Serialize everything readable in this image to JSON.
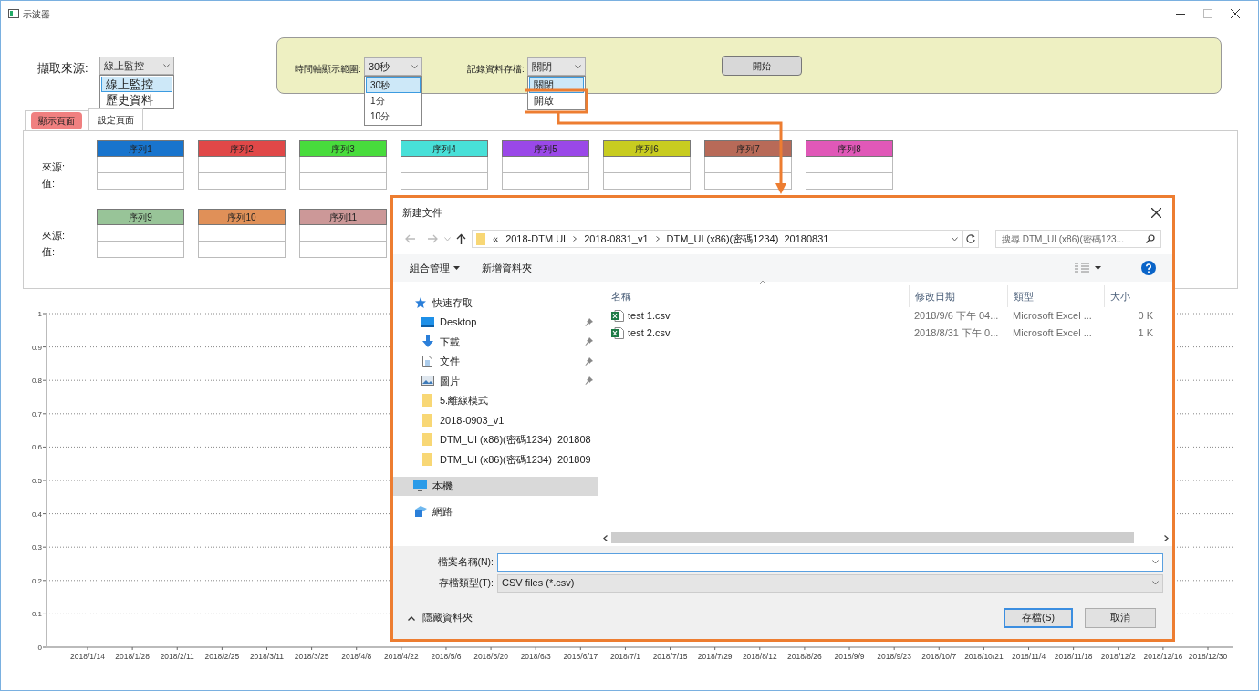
{
  "window": {
    "title": "示波器"
  },
  "source": {
    "label": "擷取來源:",
    "value": "線上監控",
    "options": [
      {
        "label": "線上監控",
        "selected": true
      },
      {
        "label": "歷史資料",
        "selected": false
      }
    ]
  },
  "settings_panel": {
    "time_range": {
      "label": "時間軸顯示範圍:",
      "value": "30秒",
      "options": [
        {
          "label": "30秒",
          "selected": true
        },
        {
          "label": "1分",
          "selected": false
        },
        {
          "label": "10分",
          "selected": false
        }
      ]
    },
    "record": {
      "label": "記錄資料存檔:",
      "value": "關閉",
      "options": [
        {
          "label": "關閉",
          "selected": true
        },
        {
          "label": "開啟",
          "selected": false
        }
      ]
    },
    "start_button": "開始"
  },
  "tabs": [
    {
      "label": "顯示頁面",
      "selected": true
    },
    {
      "label": "設定頁面",
      "selected": false
    }
  ],
  "series_groups": [
    {
      "source_label": "來源:",
      "value_label": "值:",
      "series": [
        {
          "name": "序列1",
          "color": "#1874cd"
        },
        {
          "name": "序列2",
          "color": "#e04848"
        },
        {
          "name": "序列3",
          "color": "#48dc3c"
        },
        {
          "name": "序列4",
          "color": "#48e0d8"
        },
        {
          "name": "序列5",
          "color": "#9a48e8"
        },
        {
          "name": "序列6",
          "color": "#c8cc20"
        },
        {
          "name": "序列7",
          "color": "#b86a58"
        },
        {
          "name": "序列8",
          "color": "#e058b8"
        }
      ]
    },
    {
      "source_label": "來源:",
      "value_label": "值:",
      "series": [
        {
          "name": "序列9",
          "color": "#98c498"
        },
        {
          "name": "序列10",
          "color": "#e09058"
        },
        {
          "name": "序列11",
          "color": "#cc9898"
        }
      ]
    }
  ],
  "chart_data": {
    "type": "line",
    "grid": true,
    "ylim": [
      0,
      1
    ],
    "yticks": [
      0,
      0.1,
      0.2,
      0.3,
      0.4,
      0.5,
      0.6,
      0.7,
      0.8,
      0.9,
      1
    ],
    "categories": [
      "2018/1/14",
      "2018/1/28",
      "2018/2/11",
      "2018/2/25",
      "2018/3/11",
      "2018/3/25",
      "2018/4/8",
      "2018/4/22",
      "2018/5/6",
      "2018/5/20",
      "2018/6/3",
      "2018/6/17",
      "2018/7/1",
      "2018/7/15",
      "2018/7/29",
      "2018/8/12",
      "2018/8/26",
      "2018/9/9",
      "2018/9/23",
      "2018/10/7",
      "2018/10/21",
      "2018/11/4",
      "2018/11/18",
      "2018/12/2",
      "2018/12/16",
      "2018/12/30"
    ]
  },
  "dialog": {
    "title": "新建文件",
    "breadcrumb": [
      "«",
      "2018-DTM UI",
      "2018-0831_v1",
      "DTM_UI (x86)(密碼1234)  20180831"
    ],
    "search": {
      "placeholder": "搜尋 DTM_UI (x86)(密碼123..."
    },
    "toolbar": [
      "組合管理",
      "新增資料夾"
    ],
    "nav": [
      {
        "label": "快速存取",
        "kind": "star",
        "selected": false,
        "pinned": false,
        "children": [
          {
            "label": "Desktop",
            "kind": "desktop",
            "selected": false,
            "pinned": true
          },
          {
            "label": "下載",
            "kind": "download",
            "selected": false,
            "pinned": true
          },
          {
            "label": "文件",
            "kind": "document",
            "selected": false,
            "pinned": true
          },
          {
            "label": "圖片",
            "kind": "picture",
            "selected": false,
            "pinned": true
          },
          {
            "label": "5.離線模式",
            "kind": "folder",
            "selected": false,
            "pinned": false
          },
          {
            "label": "2018-0903_v1",
            "kind": "folder",
            "selected": false,
            "pinned": false
          },
          {
            "label": "DTM_UI (x86)(密碼1234)  201808",
            "kind": "folder",
            "selected": false,
            "pinned": false
          },
          {
            "label": "DTM_UI (x86)(密碼1234)  201809",
            "kind": "folder",
            "selected": false,
            "pinned": false
          }
        ]
      },
      {
        "label": "本機",
        "kind": "pc",
        "selected": true,
        "pinned": false
      },
      {
        "label": "網路",
        "kind": "network",
        "selected": false,
        "pinned": false
      }
    ],
    "columns": [
      "名稱",
      "修改日期",
      "類型",
      "大小"
    ],
    "files": [
      {
        "name": "test 1.csv",
        "modified": "2018/9/6 下午 04...",
        "type": "Microsoft Excel ...",
        "size": "0 K"
      },
      {
        "name": "test 2.csv",
        "modified": "2018/8/31 下午 0...",
        "type": "Microsoft Excel ...",
        "size": "1 K"
      }
    ],
    "filename": {
      "label": "檔案名稱(N):"
    },
    "filetype": {
      "label": "存檔類型(T):",
      "value": "CSV files (*.csv)"
    },
    "save_button": "存檔(S)",
    "cancel_button": "取消",
    "hide_folders": "隱藏資料夾"
  }
}
